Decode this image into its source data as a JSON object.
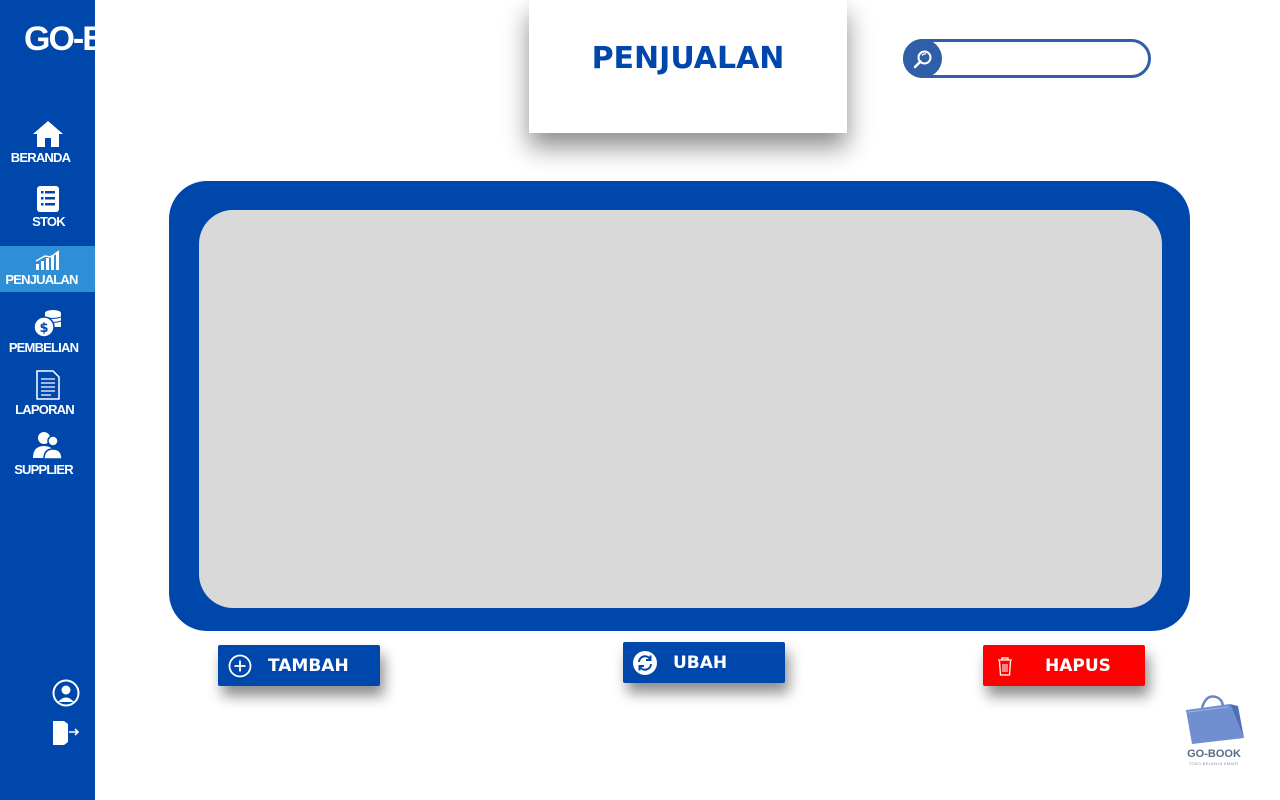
{
  "brand": {
    "name": "GO-BOOK"
  },
  "sidebar": {
    "items": [
      {
        "label": "BERANDA",
        "icon": "home-icon"
      },
      {
        "label": "STOK",
        "icon": "list-icon"
      },
      {
        "label": "PENJUALAN",
        "icon": "chart-icon",
        "active": true
      },
      {
        "label": "PEMBELIAN",
        "icon": "coins-icon"
      },
      {
        "label": "LAPORAN",
        "icon": "document-icon"
      },
      {
        "label": "SUPPLIER",
        "icon": "users-icon"
      }
    ],
    "bottom_icons": [
      "user-profile-icon",
      "logout-icon"
    ]
  },
  "header": {
    "title": "PENJUALAN"
  },
  "search": {
    "value": "",
    "placeholder": "",
    "icon": "search-icon"
  },
  "actions": {
    "add_label": "TAMBAH",
    "edit_label": "UBAH",
    "delete_label": "HAPUS"
  },
  "logo": {
    "name": "GO-BOOK",
    "tagline": "TOKO BELANJA SMART"
  },
  "colors": {
    "primary": "#0047AB",
    "active": "#2E8FD6",
    "content_bg": "#D9D9D9",
    "danger": "#FF0000",
    "search_border": "#2F5FA8"
  }
}
